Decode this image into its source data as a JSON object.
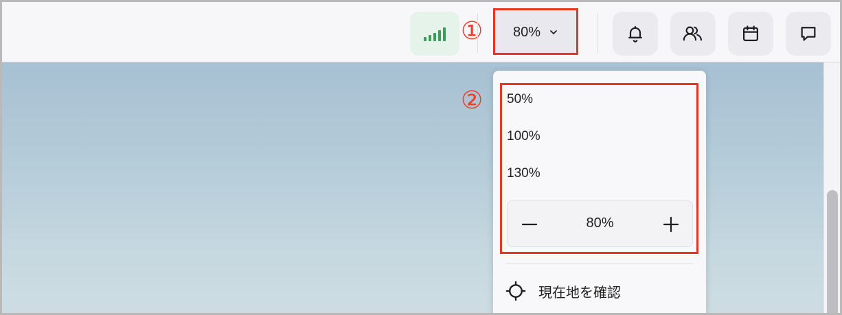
{
  "topbar": {
    "zoom_label": "80%",
    "markers": {
      "one": "①",
      "two": "②"
    }
  },
  "zoom_menu": {
    "options": [
      "50%",
      "100%",
      "130%"
    ],
    "stepper_value": "80%",
    "locate_label": "現在地を確認"
  },
  "colors": {
    "highlight": "#e8351f",
    "signal": "#3a9d5b",
    "map_top": "#a7c0d2",
    "map_bottom": "#cddde2"
  },
  "icons": [
    "signal-icon",
    "chevron-down-icon",
    "bell-icon",
    "users-icon",
    "calendar-icon",
    "chat-icon",
    "minus-icon",
    "plus-icon",
    "crosshair-icon"
  ]
}
